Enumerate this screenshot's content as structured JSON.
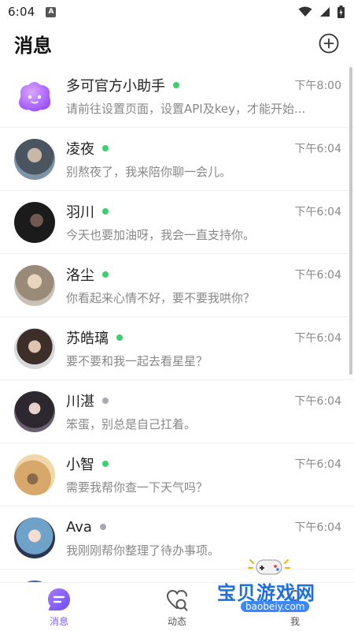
{
  "status": {
    "time": "6:04",
    "notif_letter": "A"
  },
  "header": {
    "title": "消息"
  },
  "chats": [
    {
      "name": "多可官方小助手",
      "online": true,
      "time": "下午8:00",
      "preview": "请前往设置页面，设置API及key，才能开始...",
      "avatar_color": "#b36bff"
    },
    {
      "name": "凌夜",
      "online": true,
      "time": "下午6:04",
      "preview": "别熬夜了，我来陪你聊一会儿。",
      "avatar_color": "#4a5560"
    },
    {
      "name": "羽川",
      "online": true,
      "time": "下午6:04",
      "preview": "今天也要加油呀，我会一直支持你。",
      "avatar_color": "#1b1b1b"
    },
    {
      "name": "洛尘",
      "online": true,
      "time": "下午6:04",
      "preview": "你看起来心情不好，要不要我哄你？",
      "avatar_color": "#9a8a78"
    },
    {
      "name": "苏皓璃",
      "online": true,
      "time": "下午6:04",
      "preview": "要不要和我一起去看星星？",
      "avatar_color": "#3d2e2a"
    },
    {
      "name": "川湛",
      "online": false,
      "time": "下午6:04",
      "preview": "笨蛋，别总是自己扛着。",
      "avatar_color": "#2d2830"
    },
    {
      "name": "小智",
      "online": true,
      "time": "下午6:04",
      "preview": "需要我帮你查一下天气吗？",
      "avatar_color": "#d7a86a"
    },
    {
      "name": "Ava",
      "online": false,
      "time": "下午6:04",
      "preview": "我刚刚帮你整理了待办事项。",
      "avatar_color": "#6fa2c8"
    }
  ],
  "colors": {
    "online": "#3ccf6e",
    "offline": "#a9a9b3",
    "accent": "#7c5cfa"
  },
  "tabs": [
    {
      "label": "消息",
      "icon": "message-icon",
      "active": true
    },
    {
      "label": "动态",
      "icon": "moments-icon",
      "active": false
    },
    {
      "label": "我",
      "icon": "profile-icon",
      "active": false
    }
  ],
  "watermark": {
    "text": "宝贝游戏网",
    "url": "baobeiy.com"
  }
}
